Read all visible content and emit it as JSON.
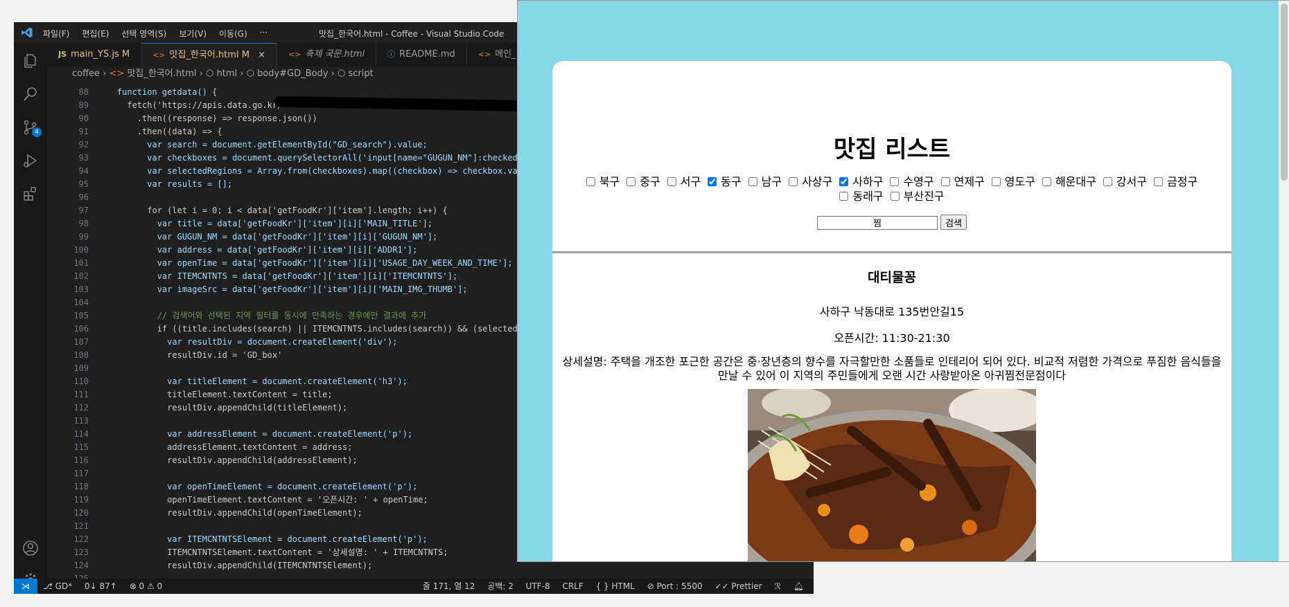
{
  "vscode": {
    "window_title": "맛집_한국어.html - Coffee - Visual Studio Code",
    "menu": [
      "파일(F)",
      "편집(E)",
      "선택 영역(S)",
      "보기(V)",
      "이동(G)",
      "···"
    ],
    "tabs": [
      {
        "label": "main_YS.js",
        "mod": "M",
        "icon": "JS"
      },
      {
        "label": "맛집_한국어.html",
        "mod": "M",
        "icon": "<>"
      },
      {
        "label": "축제 국문.html",
        "mod": "",
        "icon": "<>"
      },
      {
        "label": "README.md",
        "mod": "",
        "icon": "ⓘ"
      },
      {
        "label": "메인_",
        "mod": "",
        "icon": "<>"
      }
    ],
    "breadcrumb": [
      "coffee",
      "맛집_한국어.html",
      "html",
      "body#GD_Body",
      "script"
    ],
    "source_control_badge": "4",
    "code": [
      {
        "n": "88",
        "t": "    function getdata() {"
      },
      {
        "n": "89",
        "t": "      fetch('https://apis.data.go.kr/"
      },
      {
        "n": "90",
        "t": "        .then((response) => response.json())"
      },
      {
        "n": "91",
        "t": "        .then((data) => {"
      },
      {
        "n": "92",
        "t": "          var search = document.getElementById(\"GD_search\").value;"
      },
      {
        "n": "93",
        "t": "          var checkboxes = document.querySelectorAll('input[name=\"GUGUN_NM\"]:checked');"
      },
      {
        "n": "94",
        "t": "          var selectedRegions = Array.from(checkboxes).map((checkbox) => checkbox.value);"
      },
      {
        "n": "95",
        "t": "          var results = [];"
      },
      {
        "n": "96",
        "t": ""
      },
      {
        "n": "97",
        "t": "          for (let i = 0; i < data['getFoodKr']['item'].length; i++) {"
      },
      {
        "n": "98",
        "t": "            var title = data['getFoodKr']['item'][i]['MAIN_TITLE'];"
      },
      {
        "n": "99",
        "t": "            var GUGUN_NM = data['getFoodKr']['item'][i]['GUGUN_NM'];"
      },
      {
        "n": "100",
        "t": "            var address = data['getFoodKr']['item'][i]['ADDR1'];"
      },
      {
        "n": "101",
        "t": "            var openTime = data['getFoodKr']['item'][i]['USAGE_DAY_WEEK_AND_TIME'];"
      },
      {
        "n": "102",
        "t": "            var ITEMCNTNTS = data['getFoodKr']['item'][i]['ITEMCNTNTS'];"
      },
      {
        "n": "103",
        "t": "            var imageSrc = data['getFoodKr']['item'][i]['MAIN_IMG_THUMB'];"
      },
      {
        "n": "104",
        "t": ""
      },
      {
        "n": "105",
        "t": "            // 검색어와 선택된 지역 필터를 동시에 만족하는 경우에만 결과에 추가"
      },
      {
        "n": "106",
        "t": "            if ((title.includes(search) || ITEMCNTNTS.includes(search)) && (selectedRegi"
      },
      {
        "n": "107",
        "t": "              var resultDiv = document.createElement('div');"
      },
      {
        "n": "108",
        "t": "              resultDiv.id = 'GD_box'"
      },
      {
        "n": "109",
        "t": ""
      },
      {
        "n": "110",
        "t": "              var titleElement = document.createElement('h3');"
      },
      {
        "n": "111",
        "t": "              titleElement.textContent = title;"
      },
      {
        "n": "112",
        "t": "              resultDiv.appendChild(titleElement);"
      },
      {
        "n": "113",
        "t": ""
      },
      {
        "n": "114",
        "t": "              var addressElement = document.createElement('p');"
      },
      {
        "n": "115",
        "t": "              addressElement.textContent = address;"
      },
      {
        "n": "116",
        "t": "              resultDiv.appendChild(addressElement);"
      },
      {
        "n": "117",
        "t": ""
      },
      {
        "n": "118",
        "t": "              var openTimeElement = document.createElement('p');"
      },
      {
        "n": "119",
        "t": "              openTimeElement.textContent = '오픈시간: ' + openTime;"
      },
      {
        "n": "120",
        "t": "              resultDiv.appendChild(openTimeElement);"
      },
      {
        "n": "121",
        "t": ""
      },
      {
        "n": "122",
        "t": "              var ITEMCNTNTSElement = document.createElement('p');"
      },
      {
        "n": "123",
        "t": "              ITEMCNTNTSElement.textContent = '상세설명: ' + ITEMCNTNTS;"
      },
      {
        "n": "124",
        "t": "              resultDiv.appendChild(ITEMCNTNTSElement);"
      },
      {
        "n": "125",
        "t": ""
      }
    ],
    "status": {
      "branch": "GD*",
      "sync": "0↓ 87↑",
      "problems": "⊗ 0 ⚠ 0",
      "cursor": "줄 171, 열 12",
      "spaces": "공백: 2",
      "encoding": "UTF-8",
      "eol": "CRLF",
      "language": "HTML",
      "port": "Port : 5500",
      "prettier": "Prettier"
    }
  },
  "browser": {
    "page_title": "맛집 리스트",
    "regions": [
      {
        "label": "북구",
        "checked": false
      },
      {
        "label": "중구",
        "checked": false
      },
      {
        "label": "서구",
        "checked": false
      },
      {
        "label": "동구",
        "checked": true
      },
      {
        "label": "남구",
        "checked": false
      },
      {
        "label": "사상구",
        "checked": false
      },
      {
        "label": "사하구",
        "checked": true
      },
      {
        "label": "수영구",
        "checked": false
      },
      {
        "label": "연제구",
        "checked": false
      },
      {
        "label": "영도구",
        "checked": false
      },
      {
        "label": "해운대구",
        "checked": false
      },
      {
        "label": "강서구",
        "checked": false
      },
      {
        "label": "금정구",
        "checked": false
      },
      {
        "label": "동래구",
        "checked": false
      },
      {
        "label": "부산진구",
        "checked": false
      }
    ],
    "search_value": "찜",
    "search_button": "검색",
    "result": {
      "title": "대티물꽁",
      "address": "사하구 낙동대로 135번안길15",
      "open_time": "오픈시간: 11:30-21:30",
      "description": "상세설명: 주택을 개조한 포근한 공간은 중·장년층의 향수를 자극할만한 소품들로 인테리어 되어 있다. 비교적 저렴한 가격으로 푸짐한 음식들을 만날 수 있어 이 지역의 주민들에게 오랜 시간 사랑받아온 아귀찜전문점이다"
    },
    "background_color": "#87d7e9"
  }
}
